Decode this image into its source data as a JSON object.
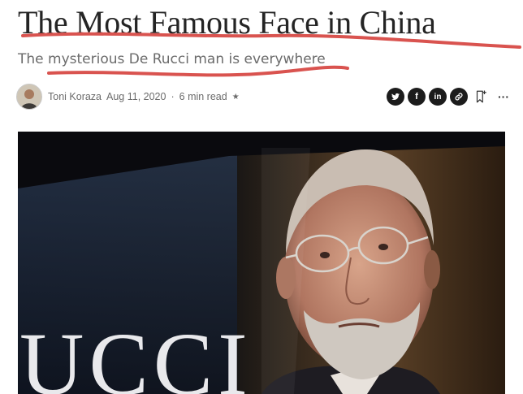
{
  "article": {
    "title": "The Most Famous Face in China",
    "subtitle": "The mysterious De Rucci man is everywhere"
  },
  "author": {
    "name": "Toni Koraza",
    "date": "Aug 11, 2020",
    "separator": "·",
    "read_time": "6 min read",
    "member_icon": "star-icon"
  },
  "share_actions": [
    {
      "icon": "twitter-icon",
      "glyph": "t"
    },
    {
      "icon": "facebook-icon",
      "glyph": "f"
    },
    {
      "icon": "linkedin-icon",
      "glyph": "in"
    },
    {
      "icon": "link-icon"
    },
    {
      "icon": "bookmark-add-icon"
    },
    {
      "icon": "more-icon",
      "glyph": "···"
    }
  ],
  "hero_image": {
    "sign_text": "UCCI"
  },
  "colors": {
    "annotation": "#d9534f",
    "title": "#242424",
    "subtitle": "#6b6b6b",
    "icon_dark": "#1c1c1c"
  }
}
